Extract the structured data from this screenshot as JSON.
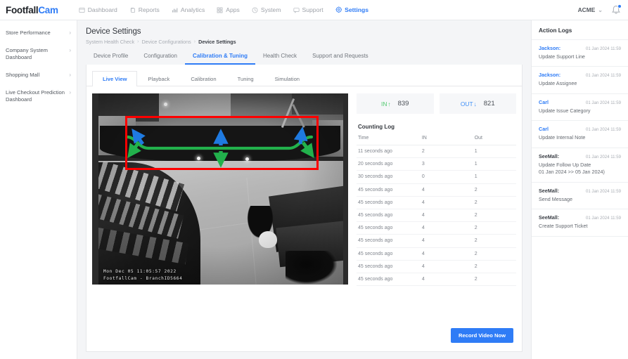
{
  "brand": {
    "part1": "Footfall",
    "part2": "Cam"
  },
  "topnav": [
    {
      "label": "Dashboard",
      "icon": "window-icon",
      "active": false
    },
    {
      "label": "Reports",
      "icon": "copy-icon",
      "active": false
    },
    {
      "label": "Analytics",
      "icon": "bar-chart-icon",
      "active": false
    },
    {
      "label": "Apps",
      "icon": "grid-icon",
      "active": false
    },
    {
      "label": "System",
      "icon": "clock-icon",
      "active": false
    },
    {
      "label": "Support",
      "icon": "chat-icon",
      "active": false
    },
    {
      "label": "Settings",
      "icon": "gear-icon",
      "active": true
    }
  ],
  "account": {
    "name": "ACME",
    "chevron": "⌄"
  },
  "sidebar": {
    "items": [
      {
        "label": "Store Performance",
        "arrow": "›"
      },
      {
        "label": "Company System Dashboard",
        "arrow": "›"
      },
      {
        "label": "Shopping Mall",
        "arrow": "›"
      },
      {
        "label": "Live Checkout Prediction Dashboard",
        "arrow": "›"
      }
    ]
  },
  "page": {
    "title": "Device Settings",
    "breadcrumb": [
      "System Health Check",
      "Device Configurations",
      "Device Settings"
    ],
    "breadcrumb_separator": "›"
  },
  "tabs_primary": [
    {
      "label": "Device Profile",
      "active": false
    },
    {
      "label": "Configuration",
      "active": false
    },
    {
      "label": "Calibration & Tuning",
      "active": true
    },
    {
      "label": "Health Check",
      "active": false
    },
    {
      "label": "Support and Requests",
      "active": false
    }
  ],
  "tabs_secondary": [
    {
      "label": "Live View",
      "active": true
    },
    {
      "label": "Playback",
      "active": false
    },
    {
      "label": "Calibration",
      "active": false
    },
    {
      "label": "Tuning",
      "active": false
    },
    {
      "label": "Simulation",
      "active": false
    }
  ],
  "video": {
    "osd_line1": "Mon Dec 05 11:05:57 2022",
    "osd_line2": "FootfallCam - BranchID5664",
    "detection_zone_color": "#ff0000",
    "count_line_color": "#22b14c",
    "direction_in_color": "#1f7ae0"
  },
  "counters": [
    {
      "label": "IN",
      "arrow": "↑",
      "value": "839",
      "color": "#4fc96e"
    },
    {
      "label": "OUT",
      "arrow": "↓",
      "value": "821",
      "color": "#3d8ef7"
    }
  ],
  "counting_log": {
    "title": "Counting Log",
    "columns": [
      "Time",
      "IN",
      "Out"
    ],
    "rows": [
      [
        "11 seconds ago",
        "2",
        "1"
      ],
      [
        "20 seconds ago",
        "3",
        "1"
      ],
      [
        "30 seconds ago",
        "0",
        "1"
      ],
      [
        "45 seconds ago",
        "4",
        "2"
      ],
      [
        "45 seconds ago",
        "4",
        "2"
      ],
      [
        "45 seconds ago",
        "4",
        "2"
      ],
      [
        "45 seconds ago",
        "4",
        "2"
      ],
      [
        "45 seconds ago",
        "4",
        "2"
      ],
      [
        "45 seconds ago",
        "4",
        "2"
      ],
      [
        "45 seconds ago",
        "4",
        "2"
      ],
      [
        "45 seconds ago",
        "4",
        "2"
      ]
    ]
  },
  "record_button": {
    "label": "Record Video Now",
    "color": "#2f7cf6"
  },
  "action_logs": {
    "title": "Action Logs",
    "items": [
      {
        "who": "Jackson:",
        "who_style": "blue",
        "time": "01 Jan 2024 11:59",
        "action": "Update Support Line"
      },
      {
        "who": "Jackson:",
        "who_style": "blue",
        "time": "01 Jan 2024 11:59",
        "action": "Update Assignee"
      },
      {
        "who": "Carl",
        "who_style": "blue",
        "time": "01 Jan 2024 11:59",
        "action": "Update Issue Category"
      },
      {
        "who": "Carl",
        "who_style": "blue",
        "time": "01 Jan 2024 11:59",
        "action": "Update Internal Note"
      },
      {
        "who": "SeeMall:",
        "who_style": "dark",
        "time": "01 Jan 2024 11:59",
        "action": "Update Follow Up Date\n01 Jan 2024 >> 05 Jan 2024)"
      },
      {
        "who": "SeeMall:",
        "who_style": "dark",
        "time": "01 Jan 2024 11:59",
        "action": "Send Message"
      },
      {
        "who": "SeeMall:",
        "who_style": "dark",
        "time": "01 Jan 2024 11:59",
        "action": "Create Support Ticket"
      }
    ]
  }
}
